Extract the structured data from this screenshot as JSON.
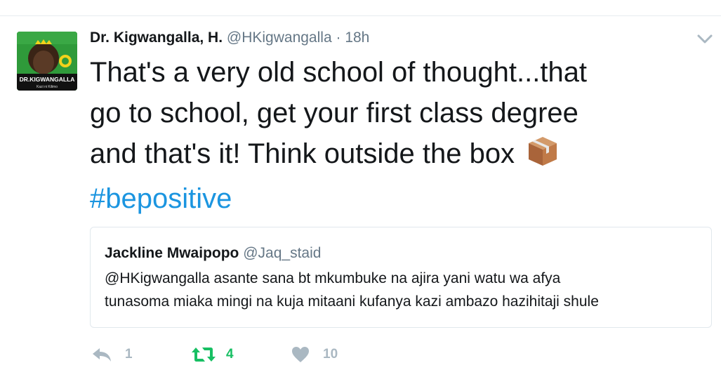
{
  "tweet": {
    "avatar_caption": "DR.KIGWANGALLA",
    "avatar_subcaption": "Kazi ni Kilimo",
    "author_name": "Dr. Kigwangalla, H.",
    "author_handle": "@HKigwangalla",
    "separator": "·",
    "timestamp": "18h",
    "text_line1": "That's a very old school of thought...that",
    "text_line2": "go to school, get your first class degree",
    "text_line3": "and that's it! Think outside the box",
    "hashtag": "#bepositive"
  },
  "quoted_tweet": {
    "author_name": "Jackline Mwaipopo",
    "author_handle": "@Jaq_staid",
    "text_line1": "@HKigwangalla asante sana bt mkumbuke na ajira yani watu wa afya",
    "text_line2": "tunasoma miaka mingi na kuja mitaani kufanya kazi ambazo hazihitaji shule"
  },
  "actions": {
    "reply_count": "1",
    "retweet_count": "4",
    "like_count": "10",
    "retweet_color": "#17bf63",
    "muted_color": "#aab8c2"
  },
  "colors": {
    "link": "#1b95e0",
    "secondary_text": "#657786"
  },
  "icons": [
    "chevron-down-icon",
    "package-emoji-icon",
    "reply-icon",
    "retweet-icon",
    "heart-icon"
  ]
}
